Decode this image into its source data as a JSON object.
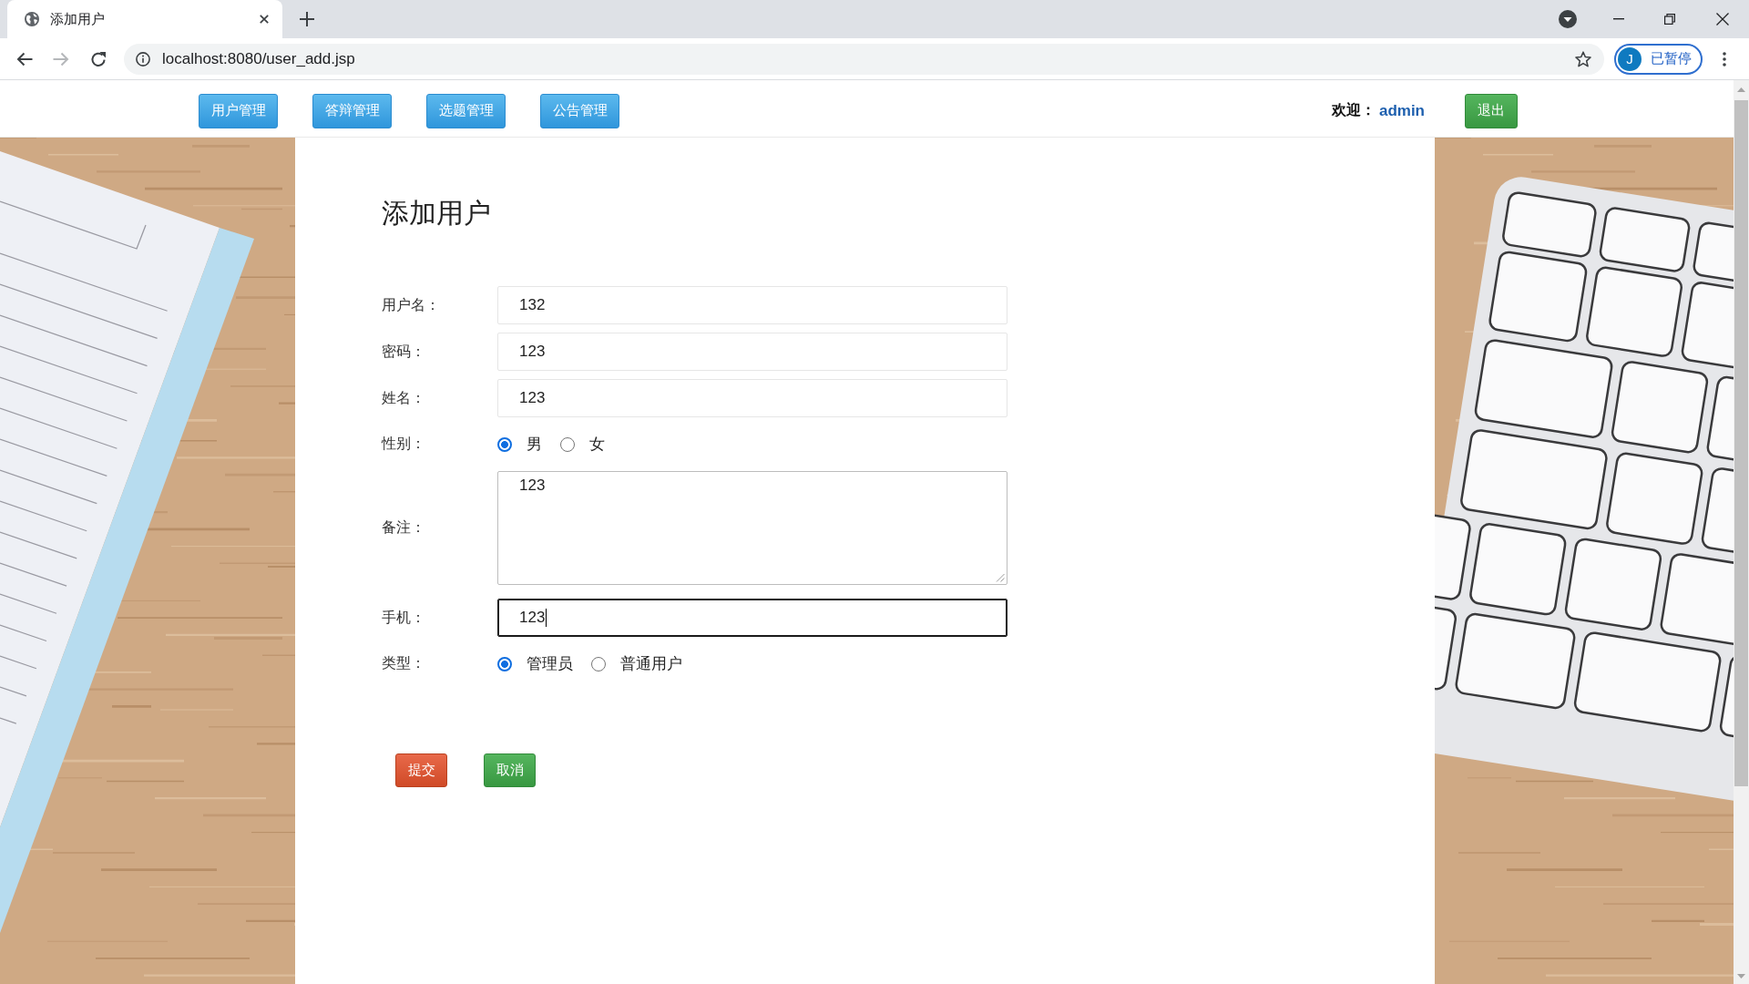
{
  "browser": {
    "tabs": [
      {
        "title": "添加用户",
        "selected": true
      }
    ],
    "can_go_forward": false,
    "address": "localhost:8080/user_add.jsp",
    "profile": {
      "initial": "J",
      "status": "已暂停"
    }
  },
  "header": {
    "nav": [
      {
        "label": "用户管理"
      },
      {
        "label": "答辩管理"
      },
      {
        "label": "选题管理"
      },
      {
        "label": "公告管理"
      }
    ],
    "welcome": "欢迎：",
    "user": "admin",
    "logout": "退出"
  },
  "form": {
    "title": "添加用户",
    "fields": [
      {
        "kind": "text",
        "label": "用户名：",
        "value": "132",
        "focused": false
      },
      {
        "kind": "text",
        "label": "密码：",
        "value": "123",
        "focused": false
      },
      {
        "kind": "text",
        "label": "姓名：",
        "value": "123",
        "focused": false
      },
      {
        "kind": "radio",
        "label": "性别：",
        "options": [
          {
            "label": "男",
            "selected": true
          },
          {
            "label": "女",
            "selected": false
          }
        ]
      },
      {
        "kind": "textarea",
        "label": "备注：",
        "value": "123"
      },
      {
        "kind": "text",
        "label": "手机：",
        "value": "123",
        "focused": true
      },
      {
        "kind": "radio",
        "label": "类型：",
        "options": [
          {
            "label": "管理员",
            "selected": true
          },
          {
            "label": "普通用户",
            "selected": false
          }
        ]
      }
    ],
    "buttons": [
      {
        "kind": "submit",
        "label": "提交"
      },
      {
        "kind": "cancel",
        "label": "取消"
      }
    ]
  }
}
